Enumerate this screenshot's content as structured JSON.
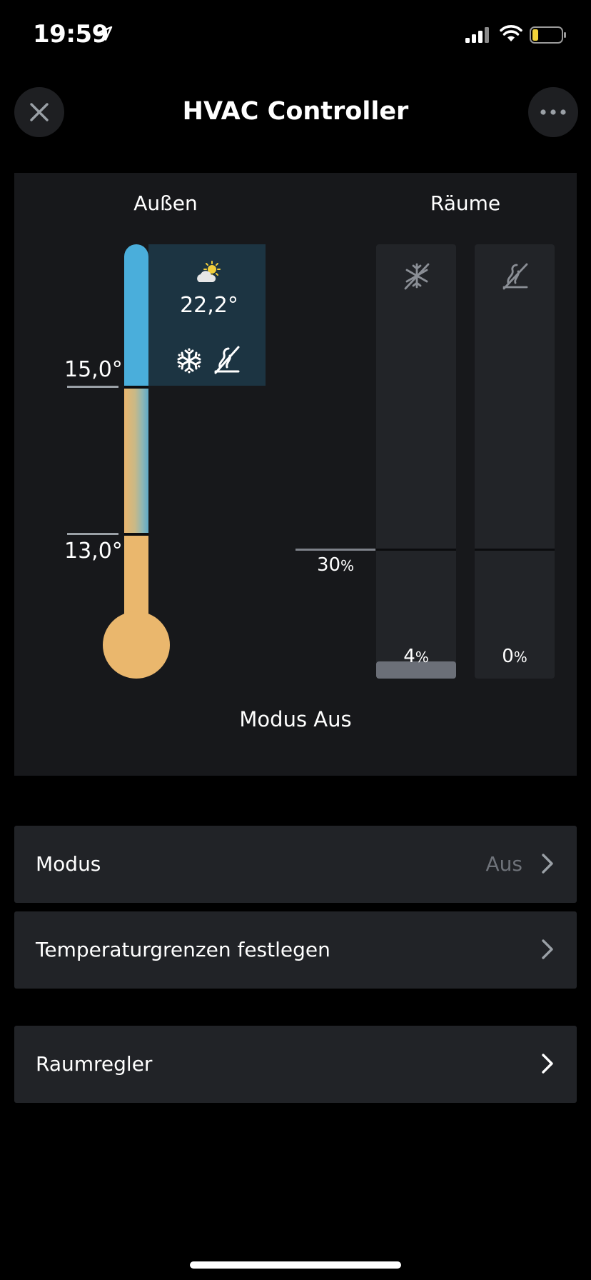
{
  "status_bar": {
    "time": "19:59",
    "icons": [
      "location-arrow-icon",
      "signal-icon",
      "wifi-icon",
      "battery-low-icon"
    ]
  },
  "header": {
    "title": "HVAC Controller",
    "close_icon": "close-icon",
    "more_icon": "more-icon"
  },
  "overview": {
    "outside_title": "Außen",
    "rooms_title": "Räume",
    "upper_limit": "15,0°",
    "lower_limit": "13,0°",
    "outside_temperature": "22,2°",
    "weather_icon": "partly-sunny-icon",
    "cooling_icon": "snowflake-icon",
    "heating_off_icon": "heating-off-icon",
    "threshold_value": "30",
    "threshold_unit": "%",
    "rooms": [
      {
        "icon": "cooling-off-icon",
        "value": "4",
        "unit": "%",
        "level": 0.04
      },
      {
        "icon": "heating-off-icon",
        "value": "0",
        "unit": "%",
        "level": 0.0
      }
    ],
    "mode_status": "Modus Aus"
  },
  "settings": {
    "mode_label": "Modus",
    "mode_value": "Aus",
    "limits_label": "Temperaturgrenzen festlegen",
    "room_controller_label": "Raumregler"
  },
  "colors": {
    "cold": "#4aaedb",
    "warm": "#eab76d",
    "weather_box": "#1c3442",
    "panel": "#17181b",
    "row": "#212327"
  }
}
